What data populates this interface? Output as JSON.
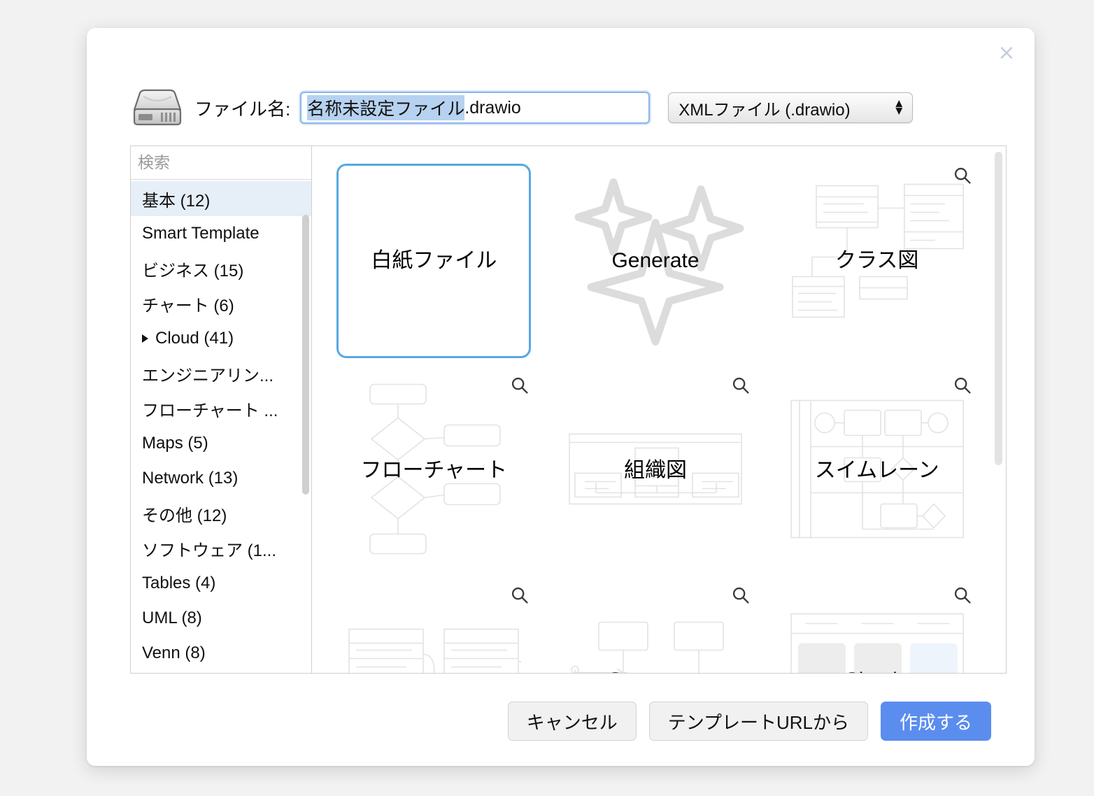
{
  "dialog": {
    "close_label": "×",
    "file_label": "ファイル名:",
    "filename_selected": "名称未設定ファイル",
    "filename_rest": ".drawio",
    "filetype_value": "XMLファイル (.drawio)",
    "drive_icon": "hard-drive-icon"
  },
  "search": {
    "placeholder": "検索",
    "value": "",
    "icon": "search-icon"
  },
  "categories": [
    {
      "label": "基本 (12)",
      "selected": true,
      "expandable": false
    },
    {
      "label": "Smart Template",
      "selected": false,
      "expandable": false
    },
    {
      "label": "ビジネス (15)",
      "selected": false,
      "expandable": false
    },
    {
      "label": "チャート (6)",
      "selected": false,
      "expandable": false
    },
    {
      "label": "Cloud (41)",
      "selected": false,
      "expandable": true
    },
    {
      "label": "エンジニアリン...",
      "selected": false,
      "expandable": false
    },
    {
      "label": "フローチャート ...",
      "selected": false,
      "expandable": false
    },
    {
      "label": "Maps (5)",
      "selected": false,
      "expandable": false
    },
    {
      "label": "Network (13)",
      "selected": false,
      "expandable": false
    },
    {
      "label": "その他 (12)",
      "selected": false,
      "expandable": false
    },
    {
      "label": "ソフトウェア (1...",
      "selected": false,
      "expandable": false
    },
    {
      "label": "Tables (4)",
      "selected": false,
      "expandable": false
    },
    {
      "label": "UML (8)",
      "selected": false,
      "expandable": false
    },
    {
      "label": "Venn (8)",
      "selected": false,
      "expandable": false
    }
  ],
  "templates": [
    {
      "label": "白紙ファイル",
      "art": "blank",
      "zoom": false,
      "selected": true
    },
    {
      "label": "Generate",
      "art": "sparkles",
      "zoom": false,
      "selected": false
    },
    {
      "label": "クラス図",
      "art": "class",
      "zoom": true,
      "selected": false
    },
    {
      "label": "フローチャート",
      "art": "flow",
      "zoom": true,
      "selected": false
    },
    {
      "label": "組織図",
      "art": "org",
      "zoom": true,
      "selected": false
    },
    {
      "label": "スイムレーン",
      "art": "swimlane",
      "zoom": true,
      "selected": false
    },
    {
      "label": "",
      "art": "er",
      "zoom": true,
      "selected": false
    },
    {
      "label": "Sequence",
      "art": "sequence",
      "zoom": true,
      "selected": false
    },
    {
      "label": "Simple",
      "art": "simple",
      "zoom": true,
      "selected": false
    }
  ],
  "footer": {
    "cancel": "キャンセル",
    "from_url": "テンプレートURLから",
    "create": "作成する"
  },
  "colors": {
    "accent_blue": "#5b8def",
    "selection_blue": "#b6d2f0",
    "tile_border_blue": "#58a8e0",
    "sidebar_selected": "#e6eef8",
    "page_bg": "#f2f2f2"
  }
}
